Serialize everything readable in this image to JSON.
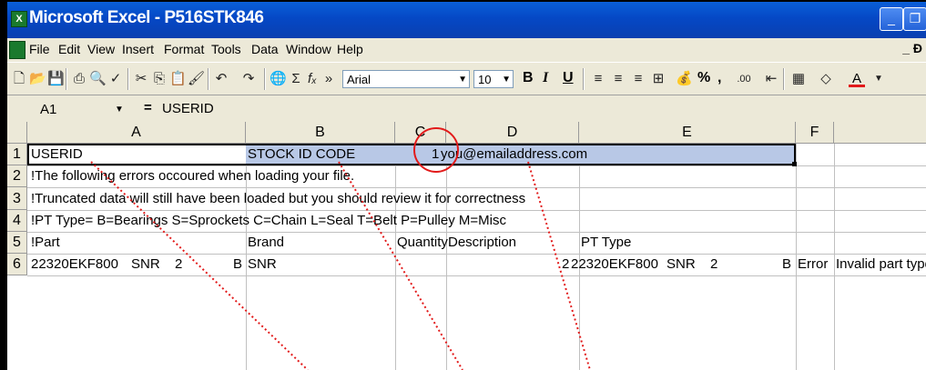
{
  "window": {
    "title": "Microsoft Excel - P516STK846",
    "app_icon": "excel-icon",
    "controls": [
      "minimize-icon",
      "restore-icon"
    ]
  },
  "menu": {
    "items": [
      "File",
      "Edit",
      "View",
      "Insert",
      "Format",
      "Tools",
      "Data",
      "Window",
      "Help"
    ],
    "restore": "_ Ɖ"
  },
  "toolbar": {
    "font": "Arial",
    "size": "10",
    "bold": "B",
    "italic": "I",
    "underline": "U",
    "percent": "%",
    "comma": ",",
    "sum": "Σ",
    "fx": "fₓ"
  },
  "formula_bar": {
    "name_box": "A1",
    "equals": "=",
    "value": "USERID"
  },
  "columns": [
    "A",
    "B",
    "C",
    "D",
    "E",
    "F"
  ],
  "rows": [
    "1",
    "2",
    "3",
    "4",
    "5",
    "6"
  ],
  "cells": {
    "a1": "USERID",
    "b1": "STOCK ID CODE",
    "c1": "1",
    "d1": "you@emailaddress.com",
    "a2": "!The following errors occoured when loading your file.",
    "a3": "!Truncated data will still have been loaded but you should review it for correctness",
    "a4": "!PT Type= B=Bearings S=Sprockets C=Chain L=Seal T=Belt P=Pulley M=Misc",
    "a5": "!Part",
    "b5": "Brand",
    "c5": "Quantity",
    "d5": "Description",
    "e5": "PT Type",
    "a6_part": "22320EKF800",
    "a6_brand": "SNR",
    "a6_qty": "2",
    "a6_type": "B",
    "b6": "SNR",
    "c6": "2",
    "d6": "22320EKF800",
    "d6_brand": "SNR",
    "d6_qty": "2",
    "e6": "B",
    "f6": "Error",
    "g6": "Invalid part type ir"
  },
  "colors": {
    "selection": "#b8c8e6",
    "annotation": "#e21a1a",
    "titlebar": "#0548c5"
  }
}
